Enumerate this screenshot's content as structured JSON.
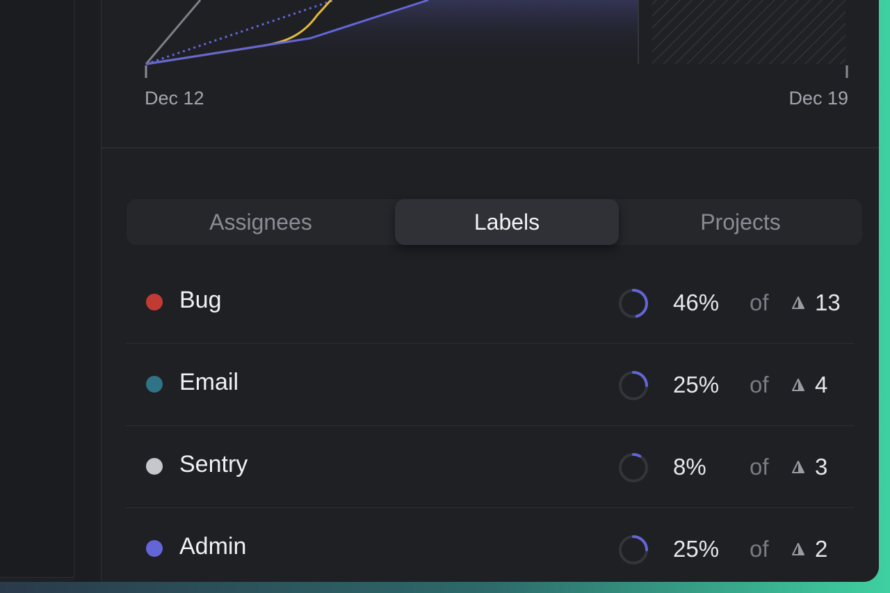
{
  "chart": {
    "x_start_label": "Dec 12",
    "x_end_label": "Dec 19",
    "colors": {
      "scope_line": "#7f7f8a",
      "started_line": "#e2b93b",
      "completed_line": "#6366d6",
      "target_line": "#6366d6"
    }
  },
  "tabs": [
    {
      "label": "Assignees",
      "active": false
    },
    {
      "label": "Labels",
      "active": true
    },
    {
      "label": "Projects",
      "active": false
    }
  ],
  "rows": [
    {
      "name": "Bug",
      "color": "#c23b33",
      "percent": "46%",
      "percent_value": 46,
      "of": "of",
      "count": "13"
    },
    {
      "name": "Email",
      "color": "#2f7386",
      "percent": "25%",
      "percent_value": 25,
      "of": "of",
      "count": "4"
    },
    {
      "name": "Sentry",
      "color": "#c6c7cc",
      "percent": "8%",
      "percent_value": 8,
      "of": "of",
      "count": "3"
    },
    {
      "name": "Admin",
      "color": "#6366d6",
      "percent": "25%",
      "percent_value": 25,
      "of": "of",
      "count": "2"
    }
  ],
  "icons": {
    "estimate": "estimate-triangle-icon",
    "progress": "progress-ring-icon"
  }
}
